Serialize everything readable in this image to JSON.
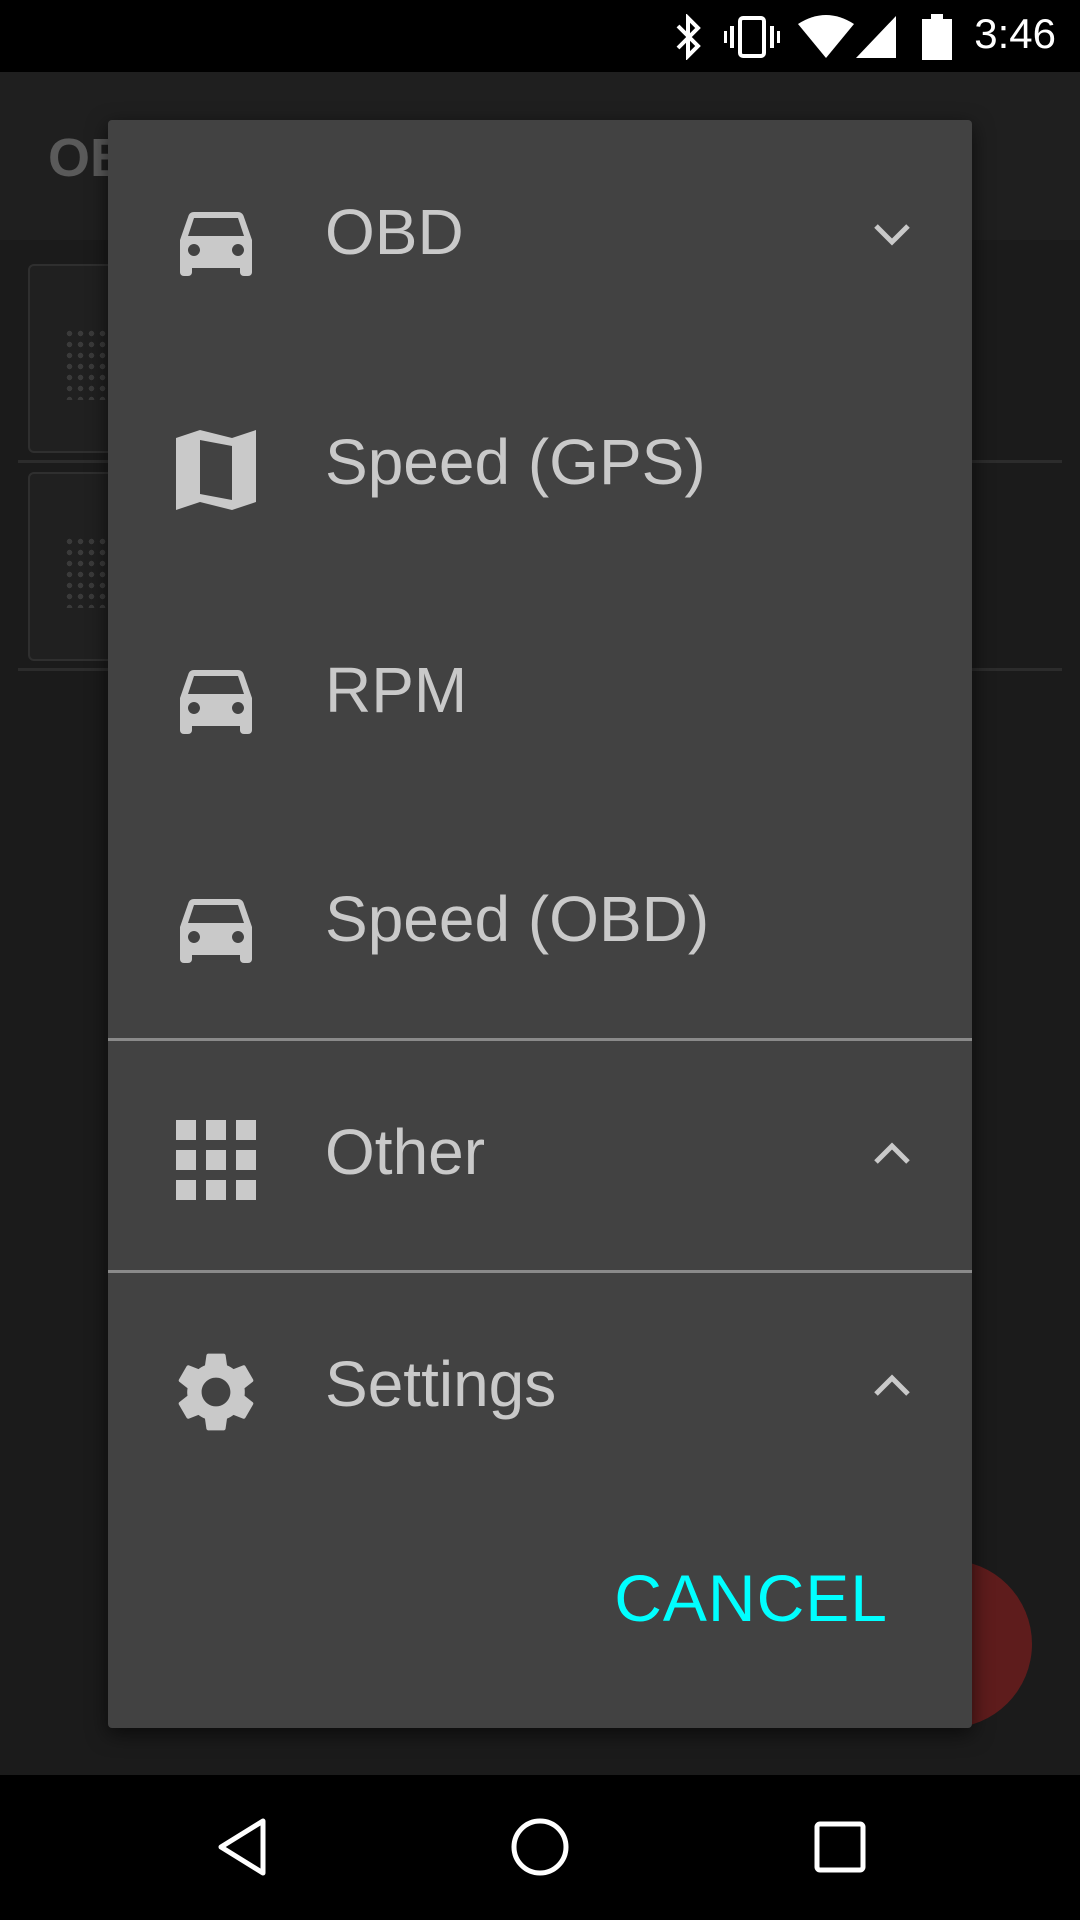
{
  "status_bar": {
    "time": "3:46",
    "icons": [
      "bluetooth-icon",
      "vibrate-icon",
      "wifi-icon",
      "signal-icon",
      "battery-icon"
    ]
  },
  "background_app": {
    "title": "OB"
  },
  "dialog": {
    "items": [
      {
        "label": "OBD",
        "icon": "car-icon",
        "expander": "chevron-down-icon"
      },
      {
        "label": "Speed (GPS)",
        "icon": "map-icon"
      },
      {
        "label": "RPM",
        "icon": "car-icon"
      },
      {
        "label": "Speed (OBD)",
        "icon": "car-icon"
      },
      {
        "label": "Other",
        "icon": "apps-grid-icon",
        "expander": "chevron-up-icon"
      },
      {
        "label": "Settings",
        "icon": "gear-icon",
        "expander": "chevron-up-icon"
      }
    ],
    "cancel_label": "CANCEL"
  },
  "colors": {
    "dialog_bg": "#424242",
    "text": "#c9c9c9",
    "accent": "#00ffff"
  },
  "nav_bar": {
    "buttons": [
      "back-icon",
      "home-icon",
      "recents-icon"
    ]
  }
}
